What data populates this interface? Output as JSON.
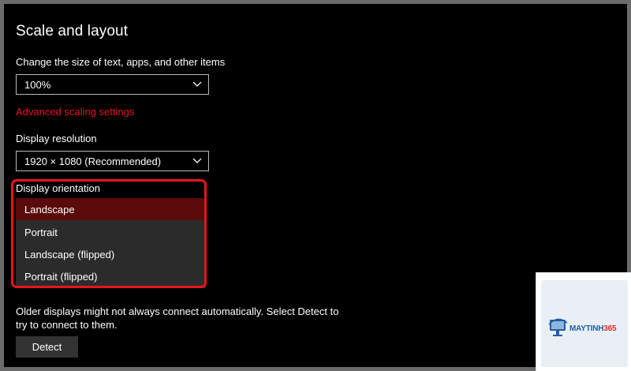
{
  "section": {
    "title": "Scale and layout"
  },
  "scale": {
    "label": "Change the size of text, apps, and other items",
    "value": "100%",
    "advanced_link": "Advanced scaling settings"
  },
  "resolution": {
    "label": "Display resolution",
    "value": "1920 × 1080 (Recommended)"
  },
  "orientation": {
    "label": "Display orientation",
    "options": [
      "Landscape",
      "Portrait",
      "Landscape (flipped)",
      "Portrait (flipped)"
    ],
    "selected": "Landscape"
  },
  "detect": {
    "note": "Older displays might not always connect automatically. Select Detect to try to connect to them.",
    "button_label": "Detect"
  },
  "watermark": {
    "brand": "MAYTINH",
    "brand_number": "365"
  },
  "colors": {
    "accent_red": "#e81123",
    "highlight_border": "#e8141e",
    "selected_item": "#5a0a0a",
    "background": "#000000"
  }
}
